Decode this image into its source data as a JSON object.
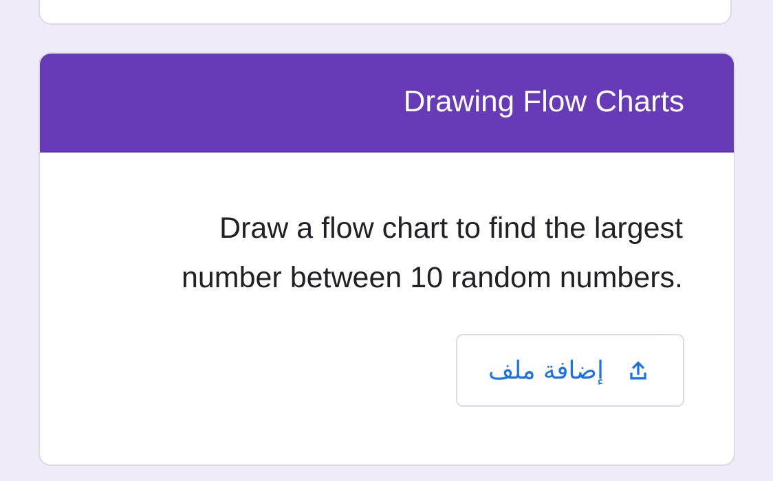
{
  "section": {
    "title": "Drawing Flow Charts"
  },
  "question": {
    "line1": "Draw a flow chart to find the largest",
    "line2": ".number between 10 random numbers"
  },
  "upload": {
    "label": "إضافة ملف",
    "icon": "upload-icon"
  },
  "colors": {
    "header": "#673ab7",
    "background": "#efebf8",
    "accent": "#1a73e8"
  }
}
